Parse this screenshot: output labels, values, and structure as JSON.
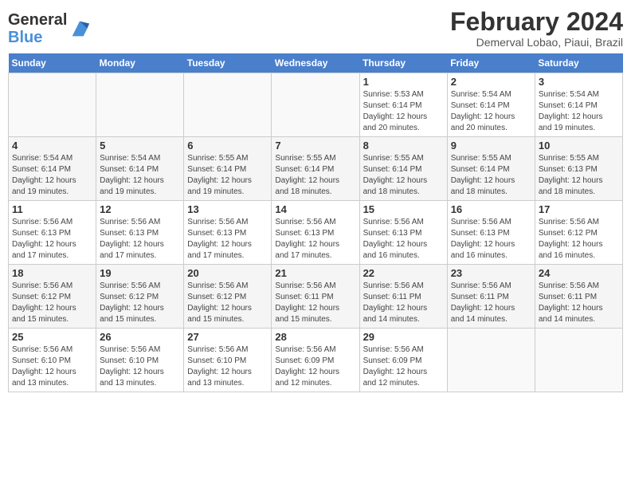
{
  "header": {
    "logo_general": "General",
    "logo_blue": "Blue",
    "month_title": "February 2024",
    "subtitle": "Demerval Lobao, Piaui, Brazil"
  },
  "days_of_week": [
    "Sunday",
    "Monday",
    "Tuesday",
    "Wednesday",
    "Thursday",
    "Friday",
    "Saturday"
  ],
  "weeks": [
    [
      {
        "day": "",
        "info": ""
      },
      {
        "day": "",
        "info": ""
      },
      {
        "day": "",
        "info": ""
      },
      {
        "day": "",
        "info": ""
      },
      {
        "day": "1",
        "info": "Sunrise: 5:53 AM\nSunset: 6:14 PM\nDaylight: 12 hours\nand 20 minutes."
      },
      {
        "day": "2",
        "info": "Sunrise: 5:54 AM\nSunset: 6:14 PM\nDaylight: 12 hours\nand 20 minutes."
      },
      {
        "day": "3",
        "info": "Sunrise: 5:54 AM\nSunset: 6:14 PM\nDaylight: 12 hours\nand 19 minutes."
      }
    ],
    [
      {
        "day": "4",
        "info": "Sunrise: 5:54 AM\nSunset: 6:14 PM\nDaylight: 12 hours\nand 19 minutes."
      },
      {
        "day": "5",
        "info": "Sunrise: 5:54 AM\nSunset: 6:14 PM\nDaylight: 12 hours\nand 19 minutes."
      },
      {
        "day": "6",
        "info": "Sunrise: 5:55 AM\nSunset: 6:14 PM\nDaylight: 12 hours\nand 19 minutes."
      },
      {
        "day": "7",
        "info": "Sunrise: 5:55 AM\nSunset: 6:14 PM\nDaylight: 12 hours\nand 18 minutes."
      },
      {
        "day": "8",
        "info": "Sunrise: 5:55 AM\nSunset: 6:14 PM\nDaylight: 12 hours\nand 18 minutes."
      },
      {
        "day": "9",
        "info": "Sunrise: 5:55 AM\nSunset: 6:14 PM\nDaylight: 12 hours\nand 18 minutes."
      },
      {
        "day": "10",
        "info": "Sunrise: 5:55 AM\nSunset: 6:13 PM\nDaylight: 12 hours\nand 18 minutes."
      }
    ],
    [
      {
        "day": "11",
        "info": "Sunrise: 5:56 AM\nSunset: 6:13 PM\nDaylight: 12 hours\nand 17 minutes."
      },
      {
        "day": "12",
        "info": "Sunrise: 5:56 AM\nSunset: 6:13 PM\nDaylight: 12 hours\nand 17 minutes."
      },
      {
        "day": "13",
        "info": "Sunrise: 5:56 AM\nSunset: 6:13 PM\nDaylight: 12 hours\nand 17 minutes."
      },
      {
        "day": "14",
        "info": "Sunrise: 5:56 AM\nSunset: 6:13 PM\nDaylight: 12 hours\nand 17 minutes."
      },
      {
        "day": "15",
        "info": "Sunrise: 5:56 AM\nSunset: 6:13 PM\nDaylight: 12 hours\nand 16 minutes."
      },
      {
        "day": "16",
        "info": "Sunrise: 5:56 AM\nSunset: 6:13 PM\nDaylight: 12 hours\nand 16 minutes."
      },
      {
        "day": "17",
        "info": "Sunrise: 5:56 AM\nSunset: 6:12 PM\nDaylight: 12 hours\nand 16 minutes."
      }
    ],
    [
      {
        "day": "18",
        "info": "Sunrise: 5:56 AM\nSunset: 6:12 PM\nDaylight: 12 hours\nand 15 minutes."
      },
      {
        "day": "19",
        "info": "Sunrise: 5:56 AM\nSunset: 6:12 PM\nDaylight: 12 hours\nand 15 minutes."
      },
      {
        "day": "20",
        "info": "Sunrise: 5:56 AM\nSunset: 6:12 PM\nDaylight: 12 hours\nand 15 minutes."
      },
      {
        "day": "21",
        "info": "Sunrise: 5:56 AM\nSunset: 6:11 PM\nDaylight: 12 hours\nand 15 minutes."
      },
      {
        "day": "22",
        "info": "Sunrise: 5:56 AM\nSunset: 6:11 PM\nDaylight: 12 hours\nand 14 minutes."
      },
      {
        "day": "23",
        "info": "Sunrise: 5:56 AM\nSunset: 6:11 PM\nDaylight: 12 hours\nand 14 minutes."
      },
      {
        "day": "24",
        "info": "Sunrise: 5:56 AM\nSunset: 6:11 PM\nDaylight: 12 hours\nand 14 minutes."
      }
    ],
    [
      {
        "day": "25",
        "info": "Sunrise: 5:56 AM\nSunset: 6:10 PM\nDaylight: 12 hours\nand 13 minutes."
      },
      {
        "day": "26",
        "info": "Sunrise: 5:56 AM\nSunset: 6:10 PM\nDaylight: 12 hours\nand 13 minutes."
      },
      {
        "day": "27",
        "info": "Sunrise: 5:56 AM\nSunset: 6:10 PM\nDaylight: 12 hours\nand 13 minutes."
      },
      {
        "day": "28",
        "info": "Sunrise: 5:56 AM\nSunset: 6:09 PM\nDaylight: 12 hours\nand 12 minutes."
      },
      {
        "day": "29",
        "info": "Sunrise: 5:56 AM\nSunset: 6:09 PM\nDaylight: 12 hours\nand 12 minutes."
      },
      {
        "day": "",
        "info": ""
      },
      {
        "day": "",
        "info": ""
      }
    ]
  ]
}
